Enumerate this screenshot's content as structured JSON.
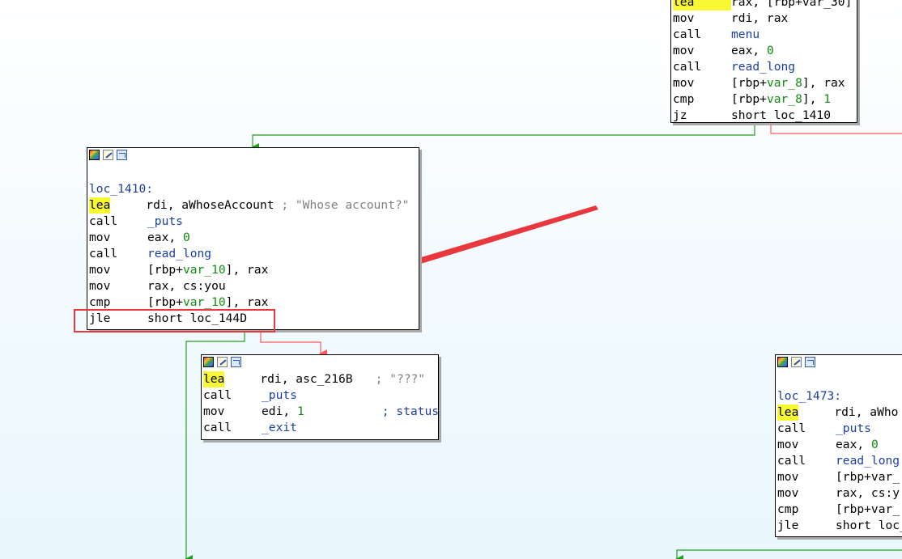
{
  "colors": {
    "edge_true": "#1fa01f",
    "edge_false": "#ff5a5a",
    "edge_flow": "#1fa01f",
    "annotation": "#e8383d",
    "mnemonic_highlight": "#f7f733"
  },
  "toolbar_icons": [
    "color-palette-icon",
    "rename-pencil-icon",
    "graph-overview-icon"
  ],
  "nodes": {
    "top": {
      "lines": [
        {
          "mn": "lea",
          "op": "rax, [rbp+var_30]"
        },
        {
          "mn": "mov",
          "op": "rdi, rax"
        },
        {
          "mn": "call",
          "op": "menu"
        },
        {
          "mn": "mov",
          "op": "eax, 0"
        },
        {
          "mn": "call",
          "op": "read_long"
        },
        {
          "mn": "mov",
          "op": "[rbp+var_8], rax"
        },
        {
          "mn": "cmp",
          "op": "[rbp+var_8], 1"
        },
        {
          "mn": "jz",
          "op": "short loc_1410"
        }
      ]
    },
    "loc_1410": {
      "label": "loc_1410:",
      "lines": [
        {
          "mn": "lea",
          "a": "rdi, aWhoseAccount",
          "comment": "; \"Whose account?\""
        },
        {
          "mn": "call",
          "a": "_puts"
        },
        {
          "mn": "mov",
          "a": "eax, ",
          "num": "0"
        },
        {
          "mn": "call",
          "a": "read_long"
        },
        {
          "mn": "mov",
          "a": "[rbp+",
          "var": "var_10",
          "b": "], rax"
        },
        {
          "mn": "mov",
          "a": "rax, cs:you"
        },
        {
          "mn": "cmp",
          "a": "[rbp+",
          "var": "var_10",
          "b": "], rax"
        },
        {
          "mn": "jle",
          "a": "short loc_144D"
        }
      ]
    },
    "exit_block": {
      "lines": [
        {
          "mn": "lea",
          "a": "rdi, asc_216B",
          "comment": "; \"???\""
        },
        {
          "mn": "call",
          "a": "_puts"
        },
        {
          "mn": "mov",
          "a": "edi, ",
          "num": "1",
          "comment": "; status"
        },
        {
          "mn": "call",
          "a": "_exit"
        }
      ]
    },
    "loc_1473": {
      "label": "loc_1473:",
      "lines": [
        {
          "mn": "lea",
          "a": "rdi, aWho"
        },
        {
          "mn": "call",
          "a": "_puts"
        },
        {
          "mn": "mov",
          "a": "eax, ",
          "num": "0"
        },
        {
          "mn": "call",
          "a": "read_long"
        },
        {
          "mn": "mov",
          "a": "[rbp+var_"
        },
        {
          "mn": "mov",
          "a": "rax, cs:y"
        },
        {
          "mn": "cmp",
          "a": "[rbp+var_"
        },
        {
          "mn": "jle",
          "a": "short loc_"
        }
      ]
    }
  }
}
